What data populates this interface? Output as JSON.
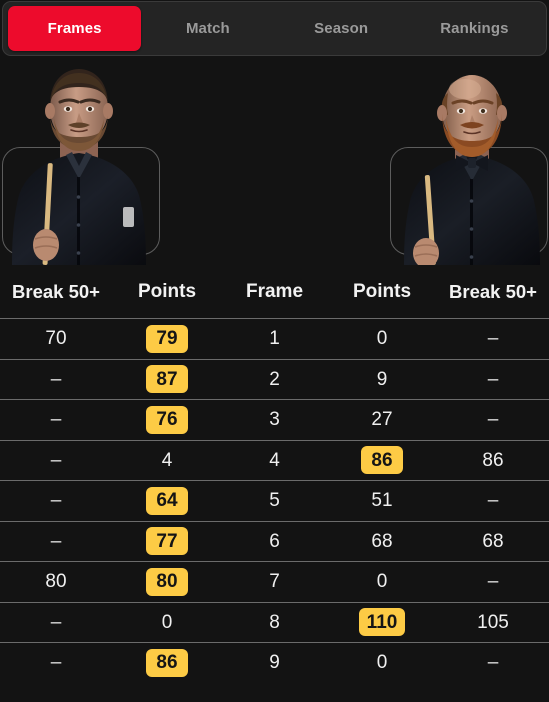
{
  "tabs": [
    {
      "label": "Frames",
      "active": true
    },
    {
      "label": "Match",
      "active": false
    },
    {
      "label": "Season",
      "active": false
    },
    {
      "label": "Rankings",
      "active": false
    }
  ],
  "colors": {
    "page_background": "#131313",
    "tabbar_background": "#242424",
    "active_tab": "#ED0B2C",
    "badge": "#FDCB45",
    "badge_text": "#151515",
    "row_divider": "#6b6b6b",
    "text_primary": "#f0f0f0",
    "text_muted": "#9a9a9a"
  },
  "players": {
    "left": {
      "name": "left-player-photo",
      "description": "snooker player with short dark hair and beard holding a cue, wearing a black shirt"
    },
    "right": {
      "name": "right-player-photo",
      "description": "bald snooker player with ginger beard and bow tie holding a cue, wearing a black shirt"
    }
  },
  "table": {
    "headers": [
      "Break 50+",
      "Points",
      "Frame",
      "Points",
      "Break 50+"
    ],
    "rows": [
      {
        "left_break": "70",
        "left_points": "79",
        "left_highlight": true,
        "frame": "1",
        "right_points": "0",
        "right_highlight": false,
        "right_break": "–"
      },
      {
        "left_break": "–",
        "left_points": "87",
        "left_highlight": true,
        "frame": "2",
        "right_points": "9",
        "right_highlight": false,
        "right_break": "–"
      },
      {
        "left_break": "–",
        "left_points": "76",
        "left_highlight": true,
        "frame": "3",
        "right_points": "27",
        "right_highlight": false,
        "right_break": "–"
      },
      {
        "left_break": "–",
        "left_points": "4",
        "left_highlight": false,
        "frame": "4",
        "right_points": "86",
        "right_highlight": true,
        "right_break": "86"
      },
      {
        "left_break": "–",
        "left_points": "64",
        "left_highlight": true,
        "frame": "5",
        "right_points": "51",
        "right_highlight": false,
        "right_break": "–"
      },
      {
        "left_break": "–",
        "left_points": "77",
        "left_highlight": true,
        "frame": "6",
        "right_points": "68",
        "right_highlight": false,
        "right_break": "68"
      },
      {
        "left_break": "80",
        "left_points": "80",
        "left_highlight": true,
        "frame": "7",
        "right_points": "0",
        "right_highlight": false,
        "right_break": "–"
      },
      {
        "left_break": "–",
        "left_points": "0",
        "left_highlight": false,
        "frame": "8",
        "right_points": "110",
        "right_highlight": true,
        "right_break": "105"
      },
      {
        "left_break": "–",
        "left_points": "86",
        "left_highlight": true,
        "frame": "9",
        "right_points": "0",
        "right_highlight": false,
        "right_break": "–"
      }
    ]
  }
}
